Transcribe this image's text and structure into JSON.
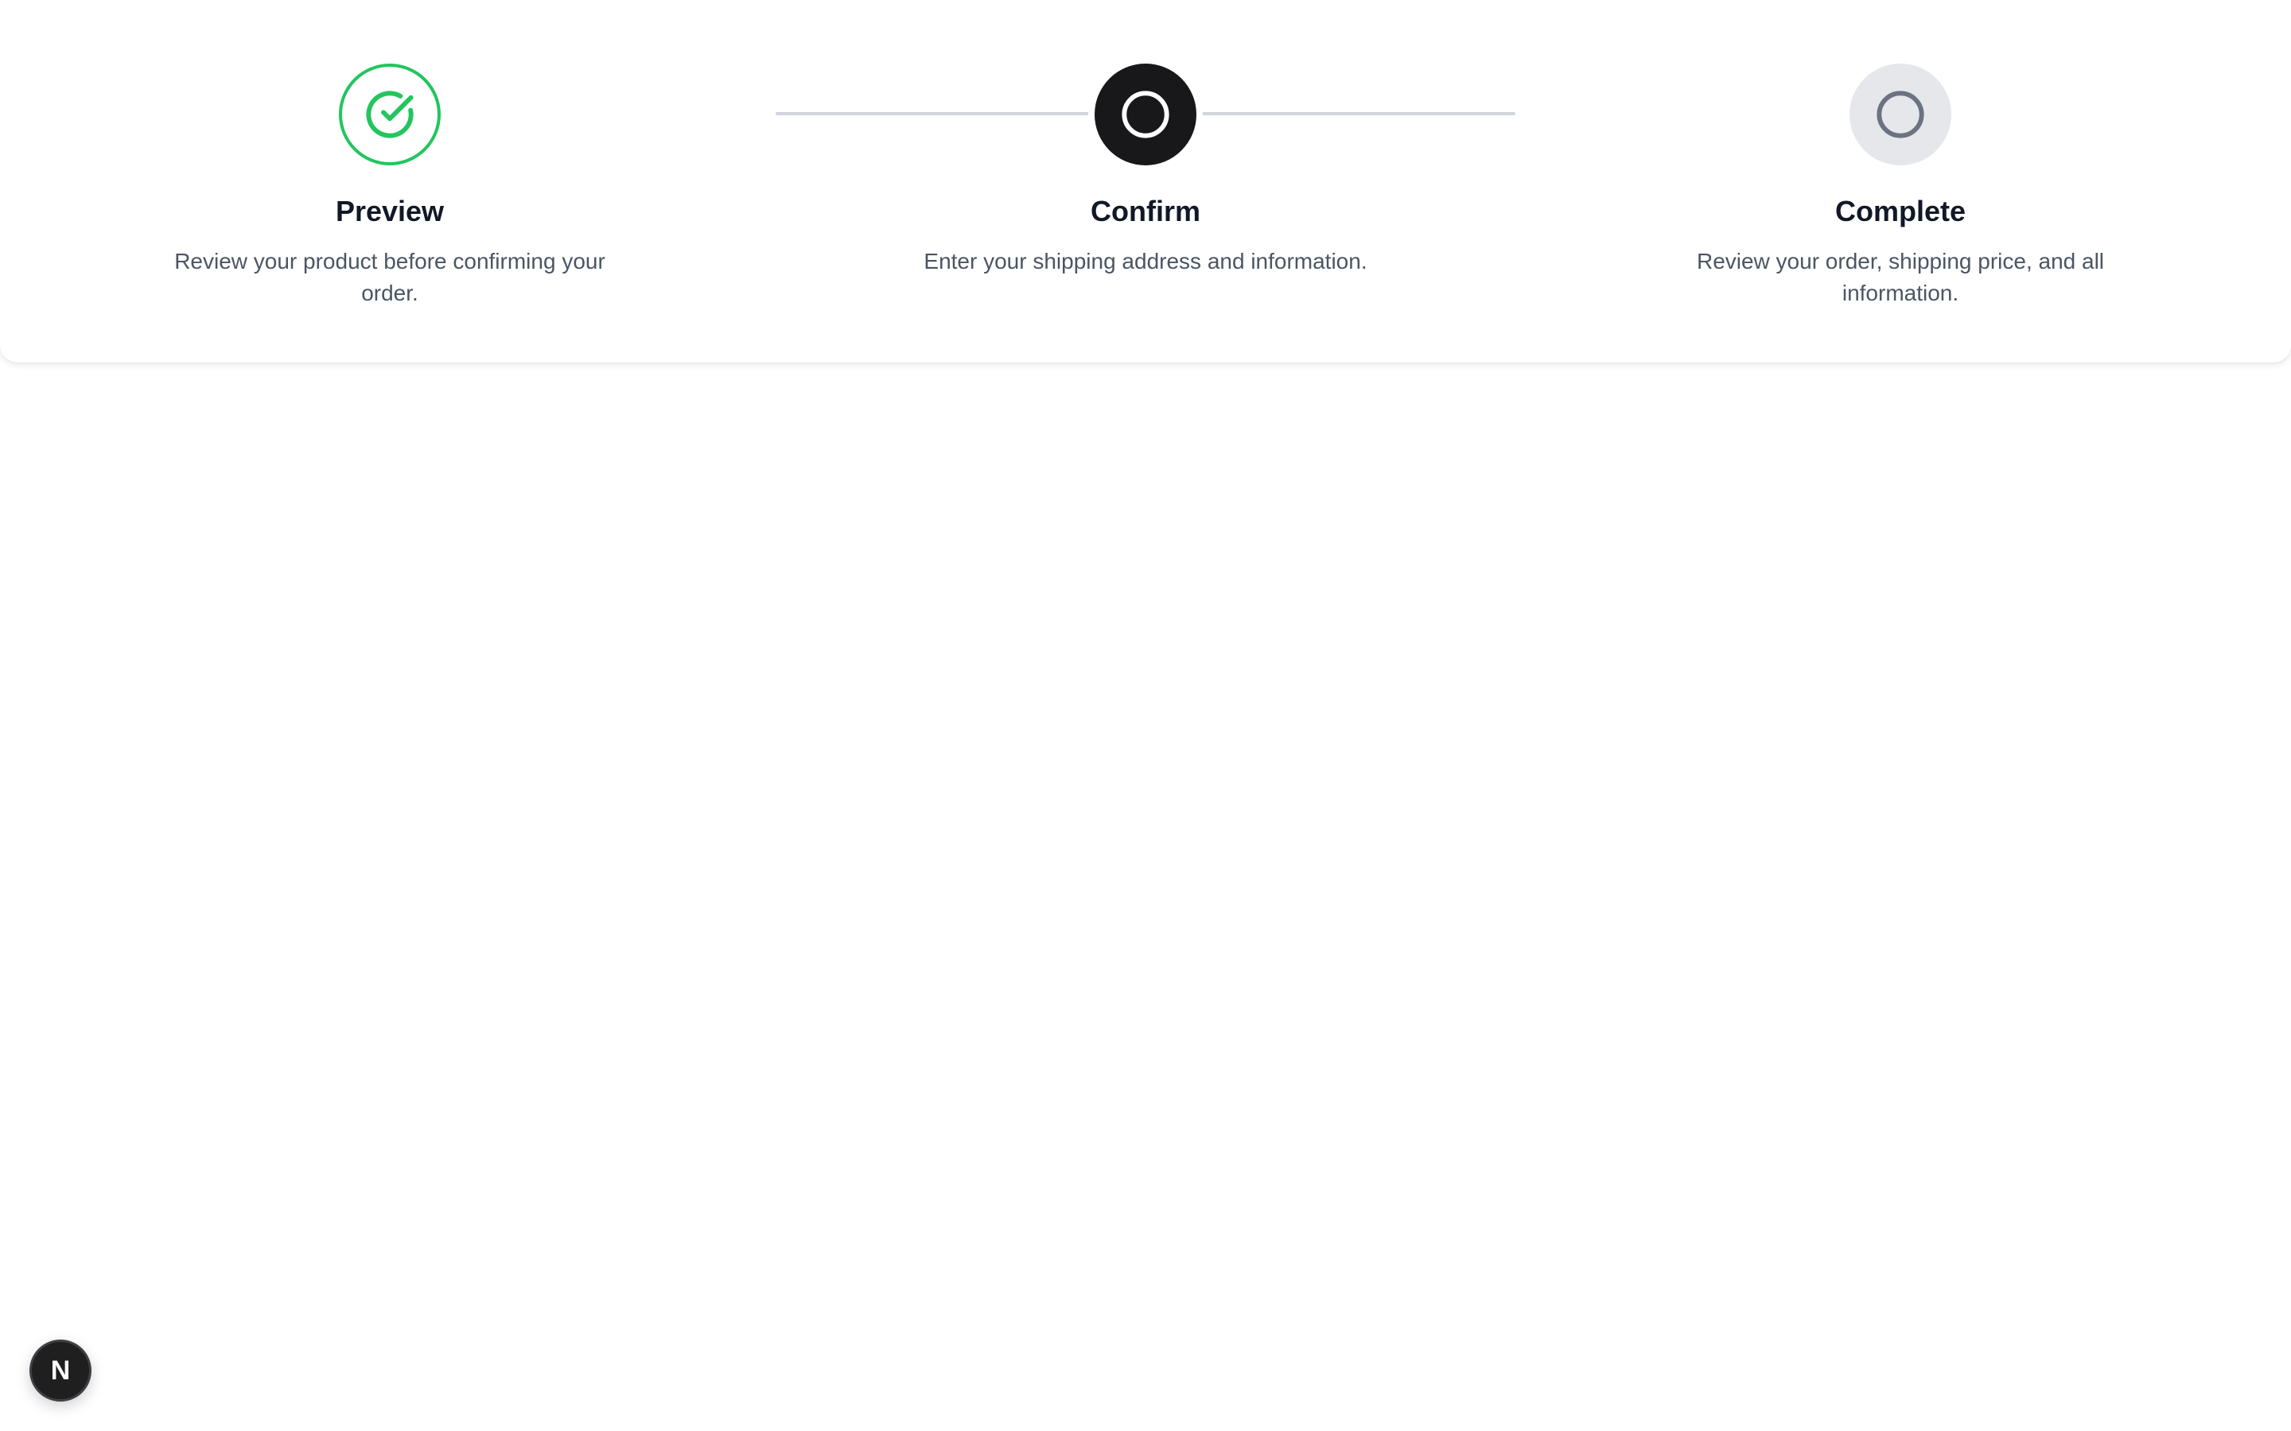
{
  "stepper": {
    "steps": [
      {
        "title": "Preview",
        "description": "Review your product before confirming your order.",
        "status": "completed",
        "icon": "check-circle-icon"
      },
      {
        "title": "Confirm",
        "description": "Enter your shipping address and information.",
        "status": "current",
        "icon": "circle-icon"
      },
      {
        "title": "Complete",
        "description": "Review your order, shipping price, and all information.",
        "status": "pending",
        "icon": "circle-icon"
      }
    ],
    "colors": {
      "completed": "#22c55e",
      "current": "#18181b",
      "pending": "#e5e7eb",
      "connector": "#d1d5db"
    }
  },
  "dev_badge": {
    "label": "N",
    "icon": "nextjs-logo-icon"
  }
}
